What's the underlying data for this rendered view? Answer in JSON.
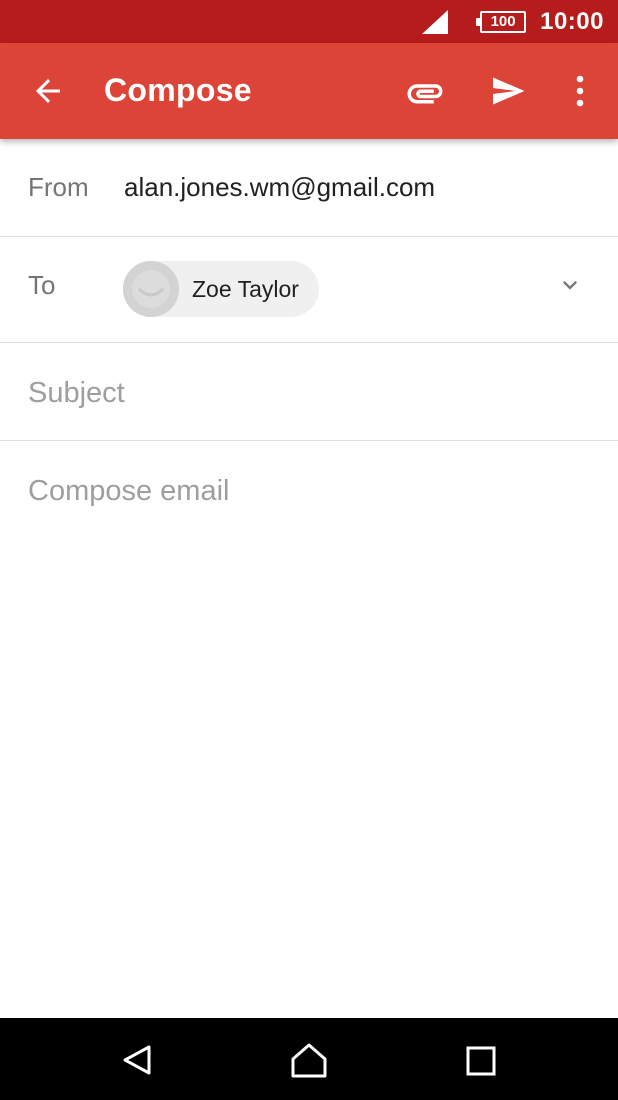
{
  "status_bar": {
    "battery": "100",
    "time": "10:00",
    "icons": [
      "cell-signal-icon",
      "battery-icon"
    ]
  },
  "app_bar": {
    "title": "Compose",
    "icons": [
      "back-arrow-icon",
      "attachment-icon",
      "send-icon",
      "more-vert-icon"
    ],
    "color": "#db4437"
  },
  "compose": {
    "from_label": "From",
    "from_value": "alan.jones.wm@gmail.com",
    "to_label": "To",
    "recipient": "Zoe Taylor",
    "subject_placeholder": "Subject",
    "body_placeholder": "Compose email"
  },
  "nav_bar": {
    "icons": [
      "nav-back-icon",
      "nav-home-icon",
      "nav-recents-icon"
    ]
  },
  "colors": {
    "status_bar": "#b71c1c",
    "accent": "#db4437",
    "hint_text": "#9e9e9e"
  }
}
